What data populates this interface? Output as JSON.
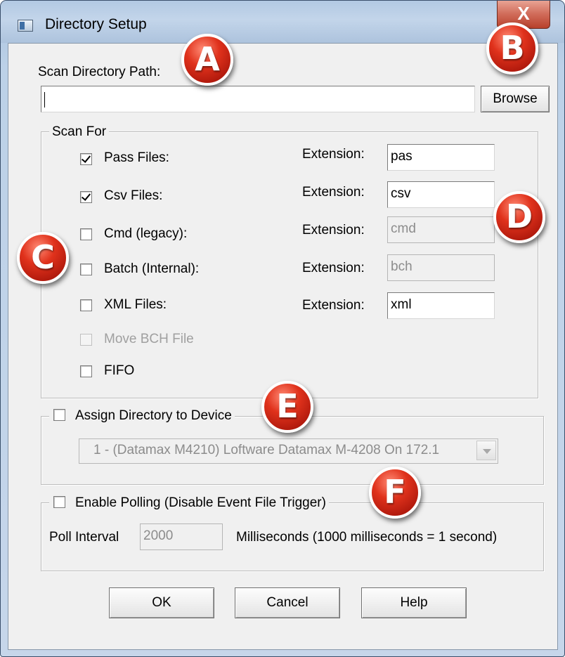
{
  "window": {
    "title": "Directory Setup",
    "close_glyph": "X"
  },
  "scan_path": {
    "label": "Scan Directory Path:",
    "value": "",
    "browse_label": "Browse"
  },
  "scan_for": {
    "title": "Scan For",
    "extension_label": "Extension:",
    "items": [
      {
        "label": "Pass Files:",
        "checked": true,
        "enabled": true,
        "extension": "pas",
        "ext_enabled": true
      },
      {
        "label": "Csv Files:",
        "checked": true,
        "enabled": true,
        "extension": "csv",
        "ext_enabled": true
      },
      {
        "label": "Cmd (legacy):",
        "checked": false,
        "enabled": true,
        "extension": "cmd",
        "ext_enabled": false
      },
      {
        "label": "Batch (Internal):",
        "checked": false,
        "enabled": true,
        "extension": "bch",
        "ext_enabled": false
      },
      {
        "label": "XML Files:",
        "checked": false,
        "enabled": true,
        "extension": "xml",
        "ext_enabled": true
      }
    ],
    "move_bch": {
      "label": "Move BCH File",
      "checked": false,
      "enabled": false
    },
    "fifo": {
      "label": "FIFO",
      "checked": false,
      "enabled": true
    }
  },
  "device": {
    "checkbox_label": "Assign Directory to Device",
    "checked": false,
    "selected": "1 - (Datamax M4210) Loftware Datamax M-4208 On 172.1"
  },
  "polling": {
    "checkbox_label": "Enable Polling (Disable Event File Trigger)",
    "checked": false,
    "interval_label": "Poll Interval",
    "interval_value": "2000",
    "units_label": "Milliseconds  (1000 milliseconds = 1 second)"
  },
  "buttons": {
    "ok": "OK",
    "cancel": "Cancel",
    "help": "Help"
  },
  "callouts": [
    "A",
    "B",
    "C",
    "D",
    "E",
    "F"
  ],
  "colors": {
    "marker_red": "#d42a16",
    "dialog_bg": "#f0f0f0",
    "frame_blue": "#bcd1e8"
  }
}
